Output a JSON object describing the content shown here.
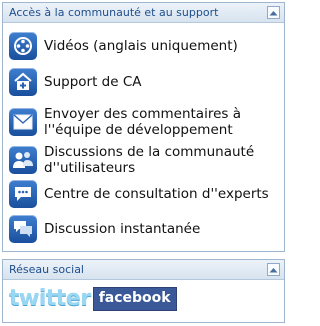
{
  "support_panel": {
    "title": "Accès à la communauté et au support",
    "items": [
      {
        "icon": "film-reel-icon",
        "label_lines": [
          "Vidéos (anglais uniquement)"
        ]
      },
      {
        "icon": "medical-cross-icon",
        "label_lines": [
          "Support de CA"
        ]
      },
      {
        "icon": "envelope-icon",
        "label_lines": [
          "Envoyer des commentaires à",
          "l''équipe de développement"
        ]
      },
      {
        "icon": "user-group-icon",
        "label_lines": [
          "Discussions de la communauté",
          "d''utilisateurs"
        ]
      },
      {
        "icon": "chat-bubble-icon",
        "label_lines": [
          "Centre de consultation d''experts"
        ]
      },
      {
        "icon": "instant-chat-icon",
        "label_lines": [
          "Discussion instantanée"
        ]
      }
    ]
  },
  "social_panel": {
    "title": "Réseau social",
    "twitter_text": "twitter",
    "facebook_text": "facebook"
  },
  "colors": {
    "header_text": "#1f4e8c",
    "border": "#9eb6ce",
    "icon_blue": "#2a62b3",
    "twitter": "#9ad7f3",
    "facebook": "#3b5998"
  }
}
